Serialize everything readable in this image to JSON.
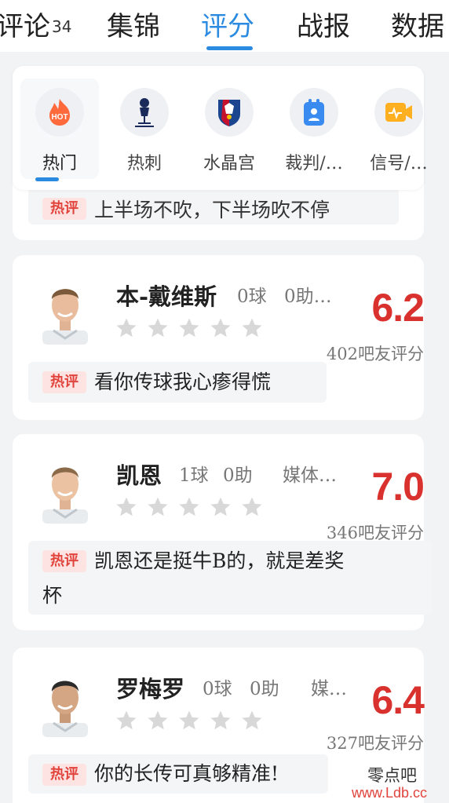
{
  "tabs": [
    {
      "label": "评论",
      "count": "34"
    },
    {
      "label": "集锦"
    },
    {
      "label": "评分"
    },
    {
      "label": "战报"
    },
    {
      "label": "数据"
    }
  ],
  "active_tab": "评分",
  "categories": [
    {
      "label": "热门",
      "icon": "hot-icon",
      "selected": true
    },
    {
      "label": "热刺",
      "icon": "tottenham-crest-icon"
    },
    {
      "label": "水晶宫",
      "icon": "crystal-palace-crest-icon"
    },
    {
      "label": "裁判/…",
      "icon": "referee-icon"
    },
    {
      "label": "信号/…",
      "icon": "signal-icon"
    }
  ],
  "previous_card": {
    "comment_badge": "热评",
    "comment": "上半场不吹，下半场吹不停"
  },
  "players": [
    {
      "name": "本-戴维斯",
      "goals": "0球",
      "assists": "0助…",
      "media": "",
      "score": "6.2",
      "votes": "402吧友评分",
      "comment_badge": "热评",
      "comment": "看你传球我心瘆得慌",
      "stars": 0
    },
    {
      "name": "凯恩",
      "goals": "1球",
      "assists": "0助",
      "media": "媒体…",
      "score": "7.0",
      "votes": "346吧友评分",
      "comment_badge": "热评",
      "comment_line1": "凯恩还是挺牛B的，就是差奖",
      "comment_line2": "杯",
      "stars": 0
    },
    {
      "name": "罗梅罗",
      "goals": "0球",
      "assists": "0助",
      "media": "媒…",
      "score": "6.4",
      "votes": "327吧友评分",
      "comment_badge": "热评",
      "comment": "你的长传可真够精准!",
      "stars": 0
    }
  ],
  "colors": {
    "accent": "#2b8be0",
    "score": "#d9322e",
    "badge_bg": "#fde3e1",
    "badge_text": "#e0443c",
    "star": "#d8d8d8"
  },
  "watermark": {
    "line1": "零点吧",
    "line2": "www.Ldb.cc"
  }
}
